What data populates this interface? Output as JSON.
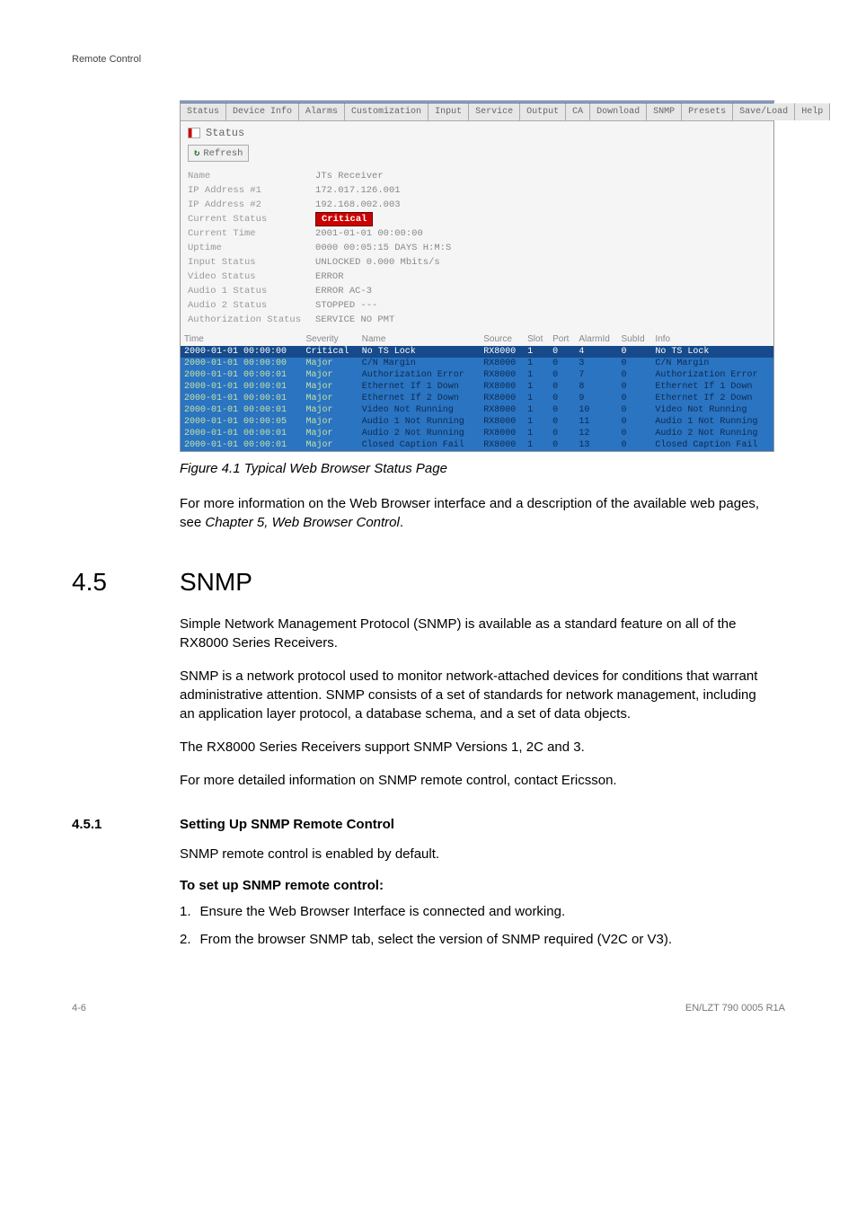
{
  "header": "Remote Control",
  "browser": {
    "tabs": [
      "Status",
      "Device Info",
      "Alarms",
      "Customization",
      "Input",
      "Service",
      "Output",
      "CA",
      "Download",
      "SNMP",
      "Presets",
      "Save/Load",
      "Help"
    ],
    "section_label": "Status",
    "refresh_label": "Refresh",
    "kv": [
      {
        "k": "Name",
        "v": "JTs Receiver"
      },
      {
        "k": "IP Address #1",
        "v": "172.017.126.001"
      },
      {
        "k": "IP Address #2",
        "v": "192.168.002.003"
      },
      {
        "k": "Current Status",
        "v": "Critical",
        "critical": true
      },
      {
        "k": "Current Time",
        "v": "2001-01-01 00:00:00"
      },
      {
        "k": "Uptime",
        "v": "0000 00:05:15 DAYS H:M:S"
      },
      {
        "k": "Input Status",
        "v": "UNLOCKED 0.000 Mbits/s"
      },
      {
        "k": "Video Status",
        "v": "ERROR"
      },
      {
        "k": "Audio 1 Status",
        "v": "ERROR AC-3"
      },
      {
        "k": "Audio 2 Status",
        "v": "STOPPED ---"
      },
      {
        "k": "Authorization Status",
        "v": "SERVICE NO PMT"
      }
    ],
    "alarm_headers": [
      "Time",
      "Severity",
      "Name",
      "Source",
      "Slot",
      "Port",
      "AlarmId",
      "SubId",
      "Info"
    ],
    "alarms": [
      {
        "time": "2000-01-01 00:00:00",
        "sev": "Critical",
        "name": "No TS Lock",
        "src": "RX8000",
        "slot": "1",
        "port": "0",
        "aid": "4",
        "sub": "0",
        "info": "No TS Lock",
        "cls": "critical"
      },
      {
        "time": "2000-01-01 00:00:00",
        "sev": "Major",
        "name": "C/N Margin",
        "src": "RX8000",
        "slot": "1",
        "port": "0",
        "aid": "3",
        "sub": "0",
        "info": "C/N Margin",
        "cls": "major"
      },
      {
        "time": "2000-01-01 00:00:01",
        "sev": "Major",
        "name": "Authorization Error",
        "src": "RX8000",
        "slot": "1",
        "port": "0",
        "aid": "7",
        "sub": "0",
        "info": "Authorization Error",
        "cls": "major"
      },
      {
        "time": "2000-01-01 00:00:01",
        "sev": "Major",
        "name": "Ethernet If 1 Down",
        "src": "RX8000",
        "slot": "1",
        "port": "0",
        "aid": "8",
        "sub": "0",
        "info": "Ethernet If 1 Down",
        "cls": "major"
      },
      {
        "time": "2000-01-01 00:00:01",
        "sev": "Major",
        "name": "Ethernet If 2 Down",
        "src": "RX8000",
        "slot": "1",
        "port": "0",
        "aid": "9",
        "sub": "0",
        "info": "Ethernet If 2 Down",
        "cls": "major"
      },
      {
        "time": "2000-01-01 00:00:01",
        "sev": "Major",
        "name": "Video Not Running",
        "src": "RX8000",
        "slot": "1",
        "port": "0",
        "aid": "10",
        "sub": "0",
        "info": "Video Not Running",
        "cls": "major"
      },
      {
        "time": "2000-01-01 00:00:05",
        "sev": "Major",
        "name": "Audio 1 Not Running",
        "src": "RX8000",
        "slot": "1",
        "port": "0",
        "aid": "11",
        "sub": "0",
        "info": "Audio 1 Not Running",
        "cls": "major"
      },
      {
        "time": "2000-01-01 00:00:01",
        "sev": "Major",
        "name": "Audio 2 Not Running",
        "src": "RX8000",
        "slot": "1",
        "port": "0",
        "aid": "12",
        "sub": "0",
        "info": "Audio 2 Not Running",
        "cls": "major"
      },
      {
        "time": "2000-01-01 00:00:01",
        "sev": "Major",
        "name": "Closed Caption Fail",
        "src": "RX8000",
        "slot": "1",
        "port": "0",
        "aid": "13",
        "sub": "0",
        "info": "Closed Caption Fail",
        "cls": "major"
      }
    ]
  },
  "figure_caption": "Figure 4.1   Typical Web Browser Status Page",
  "para_after_fig_a": "For more information on the Web Browser interface and a description of the available web pages, see ",
  "para_after_fig_b": "Chapter 5, Web Browser Control",
  "para_after_fig_c": ".",
  "sec_num": "4.5",
  "sec_title": "SNMP",
  "snmp_p1": "Simple Network Management Protocol (SNMP) is available as a standard feature on all of the RX8000 Series Receivers.",
  "snmp_p2": "SNMP is a network protocol used to monitor network-attached devices for conditions that warrant administrative attention. SNMP consists of a set of standards for network management, including an application layer protocol, a database schema, and a set of data objects.",
  "snmp_p3": "The RX8000 Series Receivers support SNMP Versions 1, 2C and 3.",
  "snmp_p4": "For more detailed information on SNMP remote control, contact Ericsson.",
  "subsec_num": "4.5.1",
  "subsec_title": "Setting Up SNMP Remote Control",
  "sub_p1": "SNMP remote control is enabled by default.",
  "sub_bold": "To set up SNMP remote control:",
  "list": [
    {
      "n": "1.",
      "t": "Ensure the Web Browser Interface is connected and working."
    },
    {
      "n": "2.",
      "t": "From the browser SNMP tab, select the version of SNMP required (V2C or V3)."
    }
  ],
  "footer_left": "4-6",
  "footer_right": "EN/LZT 790 0005 R1A"
}
